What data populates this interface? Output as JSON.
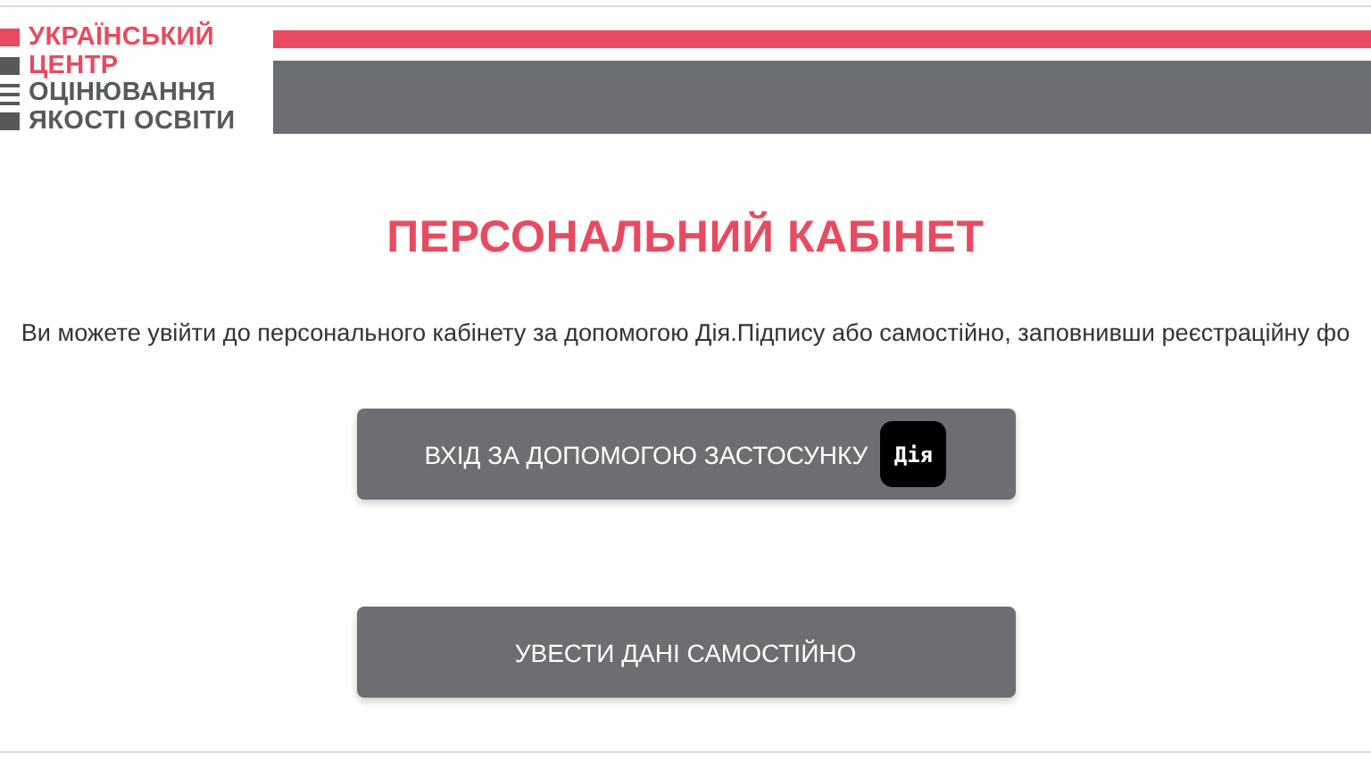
{
  "logo": {
    "lines": [
      {
        "text": "УКРАЇНСЬКИЙ",
        "kind": "accent"
      },
      {
        "text": "ЦЕНТР",
        "kind": "accent"
      },
      {
        "text": "ОЦІНЮВАННЯ",
        "kind": "plain"
      },
      {
        "text": "ЯКОСТІ ОСВІТИ",
        "kind": "plain"
      }
    ]
  },
  "title": "ПЕРСОНАЛЬНИЙ КАБІНЕТ",
  "intro": "Ви можете увійти до персонального кабінету за допомогою Дія.Підпису або самостійно, заповнивши реєстраційну фо",
  "buttons": [
    {
      "label": "ВХІД ЗА ДОПОМОГОЮ ЗАСТОСУНКУ",
      "badge": "Дія"
    },
    {
      "label": "УВЕСТИ ДАНІ САМОСТІЙНО"
    }
  ]
}
